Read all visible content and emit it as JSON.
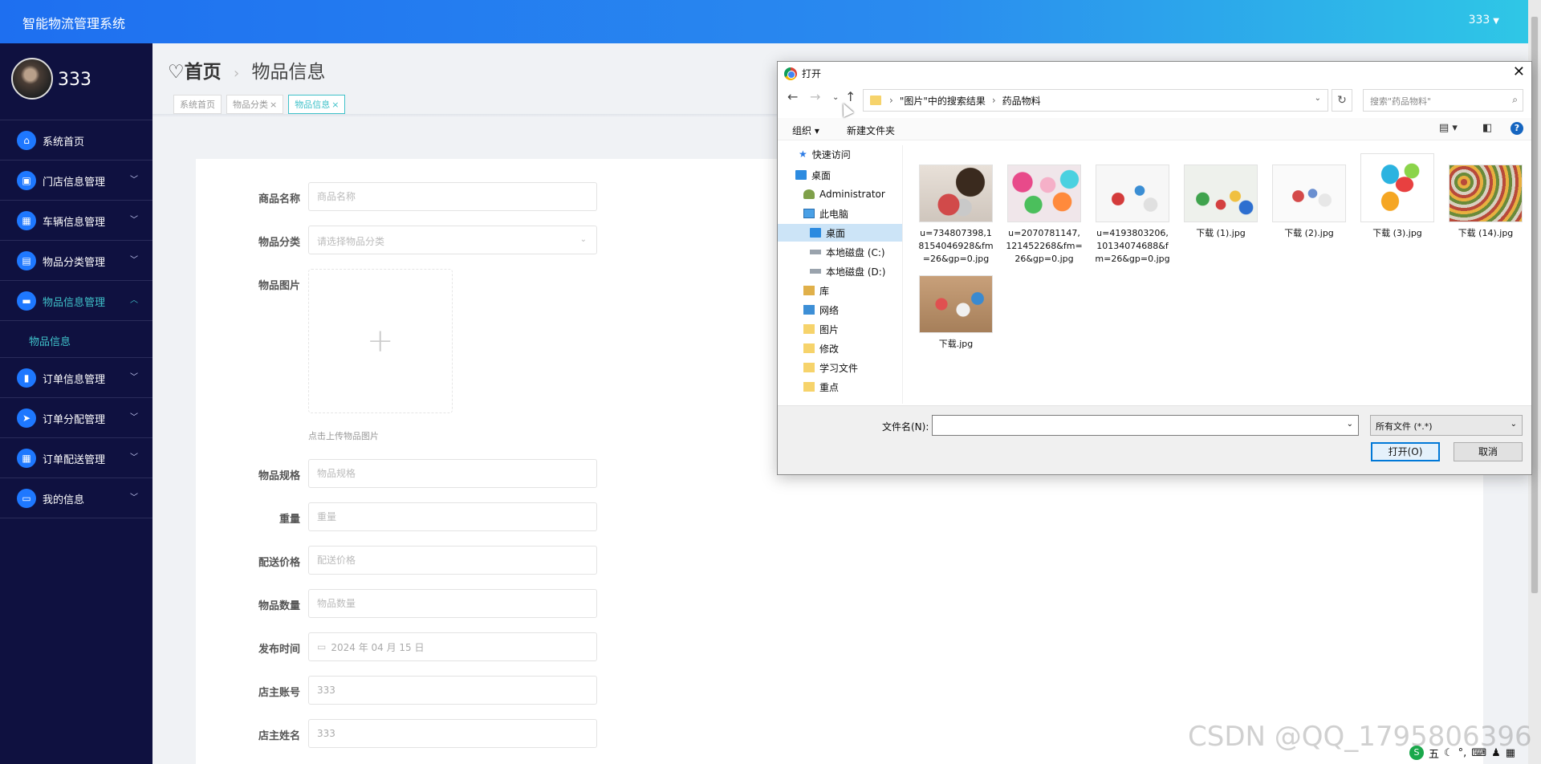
{
  "header": {
    "app_title": "智能物流管理系统",
    "user_name": "333"
  },
  "sidebar": {
    "profile_name": "333",
    "items": [
      {
        "label": "系统首页",
        "icon": "home-icon",
        "glyph": "⌂"
      },
      {
        "label": "门店信息管理",
        "icon": "store-icon",
        "glyph": "▣"
      },
      {
        "label": "车辆信息管理",
        "icon": "grid-icon",
        "glyph": "▦"
      },
      {
        "label": "物品分类管理",
        "icon": "clipboard-icon",
        "glyph": "▤"
      },
      {
        "label": "物品信息管理",
        "icon": "message-icon",
        "glyph": "▬"
      },
      {
        "label": "订单信息管理",
        "icon": "book-icon",
        "glyph": "▮"
      },
      {
        "label": "订单分配管理",
        "icon": "send-icon",
        "glyph": "➤"
      },
      {
        "label": "订单配送管理",
        "icon": "grid-icon",
        "glyph": "▦"
      },
      {
        "label": "我的信息",
        "icon": "card-icon",
        "glyph": "▭"
      }
    ],
    "sub_item": "物品信息"
  },
  "breadcrumb": {
    "home": "首页",
    "current": "物品信息"
  },
  "tags": [
    {
      "label": "系统首页",
      "closable": false
    },
    {
      "label": "物品分类",
      "closable": true
    },
    {
      "label": "物品信息",
      "closable": true
    }
  ],
  "form": {
    "name_label": "商品名称",
    "name_placeholder": "商品名称",
    "category_label": "物品分类",
    "category_placeholder": "请选择物品分类",
    "image_label": "物品图片",
    "upload_hint": "点击上传物品图片",
    "spec_label": "物品规格",
    "spec_placeholder": "物品规格",
    "weight_label": "重量",
    "weight_placeholder": "重量",
    "price_label": "配送价格",
    "price_placeholder": "配送价格",
    "qty_label": "物品数量",
    "qty_placeholder": "物品数量",
    "date_label": "发布时间",
    "date_value": "2024 年 04 月 15 日",
    "account_label": "店主账号",
    "account_value": "333",
    "owner_label": "店主姓名",
    "owner_value": "333"
  },
  "dialog": {
    "title": "打开",
    "path": [
      "\"图片\"中的搜索结果",
      "药品物料"
    ],
    "search_placeholder": "搜索\"药品物料\"",
    "organize": "组织",
    "new_folder": "新建文件夹",
    "nav": [
      {
        "label": "快速访问",
        "icon": "star-icon"
      },
      {
        "label": "桌面",
        "icon": "desktop-icon"
      },
      {
        "label": "Administrator",
        "icon": "user-icon"
      },
      {
        "label": "此电脑",
        "icon": "pc-icon"
      },
      {
        "label": "桌面",
        "icon": "desktop-icon"
      },
      {
        "label": "本地磁盘 (C:)",
        "icon": "drive-icon"
      },
      {
        "label": "本地磁盘 (D:)",
        "icon": "drive-icon"
      },
      {
        "label": "库",
        "icon": "library-icon"
      },
      {
        "label": "网络",
        "icon": "network-icon"
      },
      {
        "label": "图片",
        "icon": "folder-icon"
      },
      {
        "label": "修改",
        "icon": "folder-icon"
      },
      {
        "label": "学习文件",
        "icon": "folder-icon"
      },
      {
        "label": "重点",
        "icon": "folder-icon"
      }
    ],
    "files": [
      "u=734807398,18154046928&fm=26&gp=0.jpg",
      "u=2070781147,121452268&fm=26&gp=0.jpg",
      "u=4193803206,10134074688&fm=26&gp=0.jpg",
      "下载 (1).jpg",
      "下载 (2).jpg",
      "下载 (3).jpg",
      "下载 (14).jpg",
      "下载.jpg"
    ],
    "filename_label": "文件名(N):",
    "filename_value": "",
    "filter": "所有文件 (*.*)",
    "open_button": "打开(O)",
    "cancel_button": "取消"
  },
  "watermark": "CSDN @QQ_1795806396",
  "tray": {
    "ime": "五"
  },
  "colors": {
    "accent": "#1e78ff",
    "sidebar_bg": "#0f1140",
    "active_teal": "#3fc1c9"
  }
}
